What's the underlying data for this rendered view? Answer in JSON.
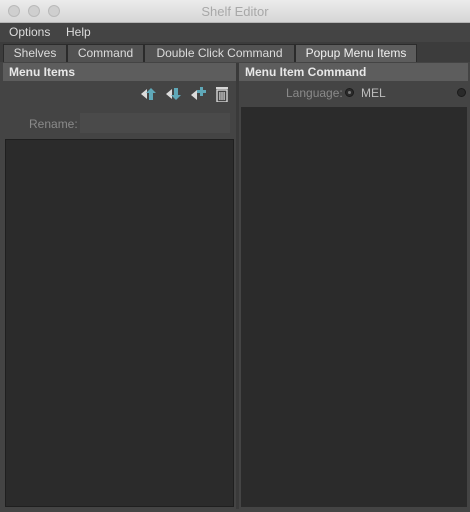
{
  "window": {
    "title": "Shelf Editor"
  },
  "menubar": {
    "items": [
      "Options",
      "Help"
    ]
  },
  "tabs": [
    {
      "label": "Shelves",
      "active": false
    },
    {
      "label": "Command",
      "active": false
    },
    {
      "label": "Double Click Command",
      "active": false
    },
    {
      "label": "Popup Menu Items",
      "active": true
    }
  ],
  "left_panel": {
    "header": "Menu Items",
    "toolbar": {
      "icons": [
        "move-up-icon",
        "move-down-icon",
        "new-item-icon",
        "trash-icon"
      ]
    },
    "rename": {
      "label": "Rename:",
      "value": ""
    }
  },
  "right_panel": {
    "header": "Menu Item Command",
    "language": {
      "label": "Language:",
      "options": [
        {
          "label": "MEL",
          "selected": true
        },
        {
          "label": "",
          "selected": false
        }
      ]
    }
  },
  "colors": {
    "accent_icon": "#5fa8b8",
    "panel_header": "#5d5d5d",
    "field_bg": "#2b2b2b",
    "window_bg": "#444444"
  }
}
